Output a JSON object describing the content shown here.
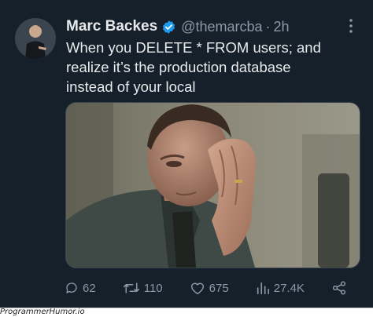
{
  "tweet": {
    "author_name": "Marc Backes",
    "handle": "@themarcba",
    "separator": "·",
    "time": "2h",
    "text_lines": [
      "When you DELETE * FROM users; and",
      "realize it’s the production database",
      "instead of your local"
    ],
    "verified_icon": "verified-badge-icon",
    "more_icon": "more-vertical-icon"
  },
  "actions": {
    "replies": "62",
    "retweets": "110",
    "likes": "675",
    "views": "27.4K"
  },
  "colors": {
    "background": "#15202b",
    "text": "#e7e9ea",
    "secondary": "#8b98a5",
    "verified": "#1d9bf0"
  },
  "watermark": "ProgrammerHumor.io"
}
